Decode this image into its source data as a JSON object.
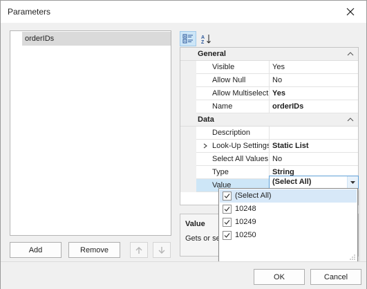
{
  "window": {
    "title": "Parameters"
  },
  "parameters": {
    "items": [
      "orderIDs"
    ]
  },
  "left_buttons": {
    "add": "Add",
    "remove": "Remove"
  },
  "toolbar": {
    "categorized_icon": "categorized-icon",
    "sort_icon": "sort-alphabetical-icon"
  },
  "grid": {
    "general": {
      "label": "General",
      "rows": [
        {
          "name": "Visible",
          "value": "Yes",
          "bold": false
        },
        {
          "name": "Allow Null",
          "value": "No",
          "bold": false
        },
        {
          "name": "Allow Multiselect",
          "value": "Yes",
          "bold": true
        },
        {
          "name": "Name",
          "value": "orderIDs",
          "bold": true
        }
      ]
    },
    "data": {
      "label": "Data",
      "rows": [
        {
          "name": "Description",
          "value": "",
          "bold": false
        },
        {
          "name": "Look-Up Settings",
          "value": "Static List",
          "bold": true
        },
        {
          "name": "Select All Values",
          "value": "No",
          "bold": false
        },
        {
          "name": "Type",
          "value": "String",
          "bold": true
        },
        {
          "name": "Value",
          "value": "(Select All)",
          "bold": true
        }
      ]
    }
  },
  "dropdown": {
    "items": [
      {
        "label": "(Select All)",
        "checked": true
      },
      {
        "label": "10248",
        "checked": true
      },
      {
        "label": "10249",
        "checked": true
      },
      {
        "label": "10250",
        "checked": true
      }
    ]
  },
  "description": {
    "title": "Value",
    "text": "Gets or se"
  },
  "dialog_buttons": {
    "ok": "OK",
    "cancel": "Cancel"
  },
  "colors": {
    "selection": "#cde6f7",
    "editor_border": "#5e9fd6",
    "highlight": "#d7e8f8"
  }
}
